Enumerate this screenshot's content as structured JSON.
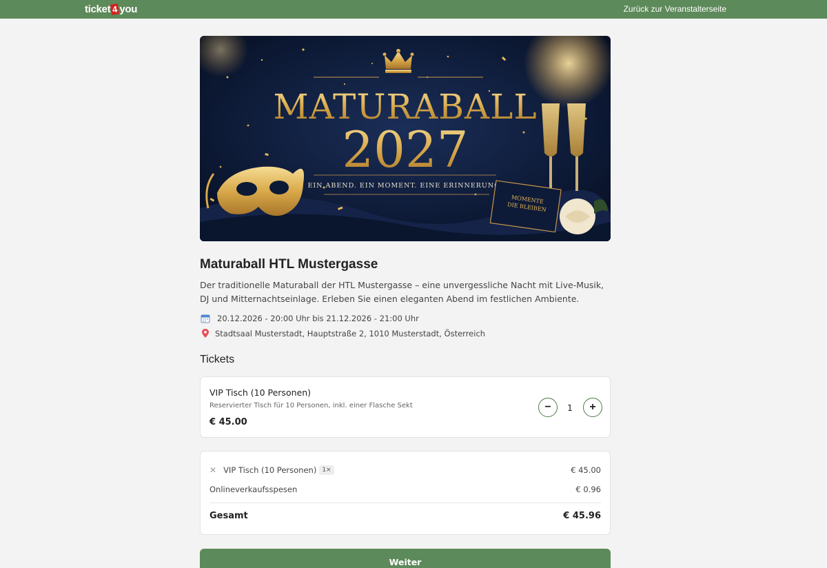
{
  "header": {
    "logo_left": "ticket",
    "logo_num": "4",
    "logo_right": "you",
    "back_link": "Zurück zur Veranstalterseite"
  },
  "banner": {
    "title": "MATURABALL",
    "year": "2027",
    "tagline": "EIN ABEND. EIN MOMENT. EINE ERINNERUNG.",
    "card_line1": "MOMENTE",
    "card_line2": "DIE BLEIBEN"
  },
  "event": {
    "title": "Maturaball HTL Mustergasse",
    "description": "Der traditionelle Maturaball der HTL Mustergasse – eine unvergessliche Nacht mit Live-Musik, DJ und Mitternachtseinlage. Erleben Sie einen eleganten Abend im festlichen Ambiente.",
    "date": "20.12.2026 - 20:00 Uhr bis 21.12.2026 - 21:00 Uhr",
    "location": "Stadtsaal Musterstadt, Hauptstraße 2, 1010 Musterstadt, Österreich",
    "date_icon": "calendar-icon",
    "location_icon": "map-pin-icon"
  },
  "tickets": {
    "heading": "Tickets",
    "items": [
      {
        "name": "VIP Tisch (10 Personen)",
        "description": "Reservierter Tisch für 10 Personen, inkl. einer Flasche Sekt",
        "price": "€ 45.00",
        "quantity": "1",
        "minus": "−",
        "plus": "+"
      }
    ]
  },
  "summary": {
    "items": [
      {
        "remove": "✕",
        "name": "VIP Tisch (10 Personen)",
        "qty_badge": "1×",
        "price": "€ 45.00"
      }
    ],
    "fee_label": "Onlineverkaufsspesen",
    "fee_value": "€ 0.96",
    "total_label": "Gesamt",
    "total_value": "€ 45.96"
  },
  "actions": {
    "continue": "Weiter"
  },
  "colors": {
    "brand_green": "#5d8a5a",
    "gold": "#d9a94a",
    "navy": "#0c1a33"
  }
}
